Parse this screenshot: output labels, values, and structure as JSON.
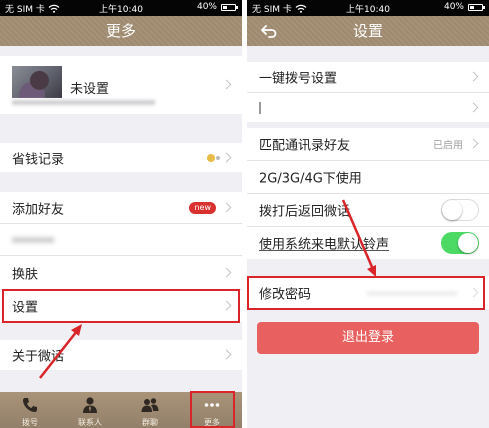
{
  "status_bar": {
    "carrier": "无 SIM 卡",
    "time": "上午10:40",
    "battery_text": "40%",
    "battery_level": 0.4
  },
  "more_screen": {
    "title": "更多",
    "profile": {
      "name": "未设置"
    },
    "savings": {
      "label": "省钱记录",
      "icon": "coin-icon"
    },
    "add_friend": {
      "label": "添加好友",
      "badge": "new"
    },
    "skin": {
      "label": "换肤"
    },
    "settings": {
      "label": "设置"
    },
    "about": {
      "label": "关于微话"
    },
    "tabs": [
      {
        "label": "拨号",
        "icon": "phone-icon"
      },
      {
        "label": "联系人",
        "icon": "contact-icon"
      },
      {
        "label": "群聊",
        "icon": "group-icon"
      },
      {
        "label": "更多",
        "icon": "more-dots-icon"
      }
    ]
  },
  "settings_screen": {
    "title": "设置",
    "back_icon": "back-arrow-icon",
    "one_key_dial": {
      "label": "一键拨号设置"
    },
    "match_contacts": {
      "label": "匹配通讯录好友",
      "status": "已启用"
    },
    "network_usage": {
      "label": "2G/3G/4G下使用"
    },
    "return_after_call": {
      "label": "拨打后返回微话",
      "on": false
    },
    "system_ringtone": {
      "label": "使用系统来电默认铃声",
      "on": true
    },
    "change_password": {
      "label": "修改密码"
    },
    "logout": {
      "label": "退出登录"
    }
  },
  "colors": {
    "highlight": "#d9252a",
    "header": "#a38e73",
    "toggle_on": "#4cd964",
    "logout": "#e8605f"
  }
}
